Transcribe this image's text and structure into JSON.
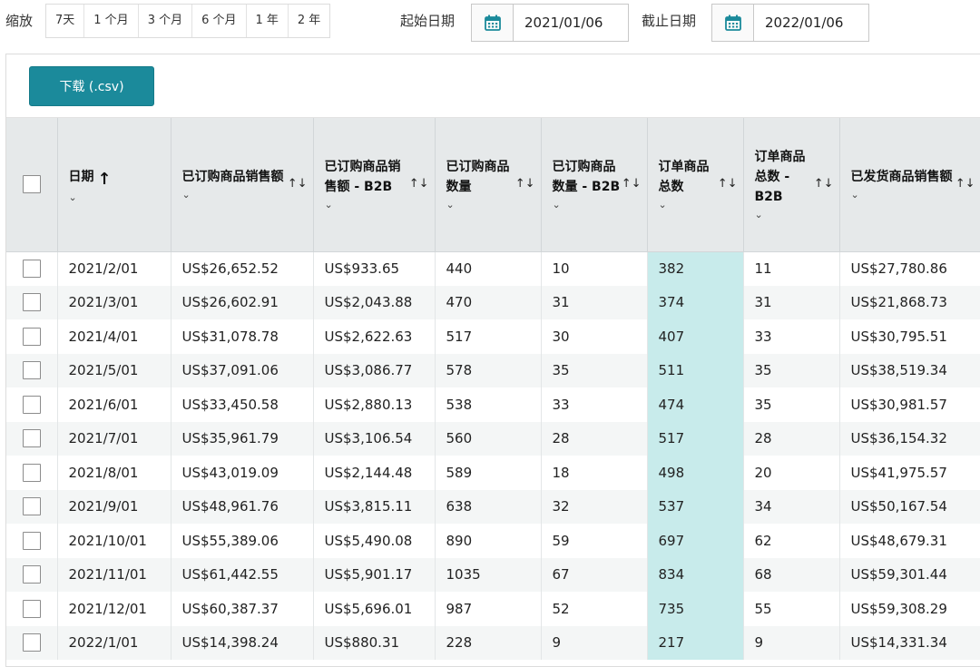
{
  "filters": {
    "zoom_label": "缩放",
    "zoom_options": [
      "7天",
      "1 个月",
      "3 个月",
      "6 个月",
      "1 年",
      "2 年"
    ],
    "start_label": "起始日期",
    "start_value": "2021/01/06",
    "end_label": "截止日期",
    "end_value": "2022/01/06"
  },
  "toolbar": {
    "download_label": "下载 (.csv)"
  },
  "table": {
    "headers": [
      "日期",
      "已订购商品销售额",
      "已订购商品销售额 - B2B",
      "已订购商品数量",
      "已订购商品数量 - B2B",
      "订单商品总数",
      "订单商品总数 - B2B",
      "已发货商品销售额"
    ],
    "rows": [
      [
        "2021/2/01",
        "US$26,652.52",
        "US$933.65",
        "440",
        "10",
        "382",
        "11",
        "US$27,780.86"
      ],
      [
        "2021/3/01",
        "US$26,602.91",
        "US$2,043.88",
        "470",
        "31",
        "374",
        "31",
        "US$21,868.73"
      ],
      [
        "2021/4/01",
        "US$31,078.78",
        "US$2,622.63",
        "517",
        "30",
        "407",
        "33",
        "US$30,795.51"
      ],
      [
        "2021/5/01",
        "US$37,091.06",
        "US$3,086.77",
        "578",
        "35",
        "511",
        "35",
        "US$38,519.34"
      ],
      [
        "2021/6/01",
        "US$33,450.58",
        "US$2,880.13",
        "538",
        "33",
        "474",
        "35",
        "US$30,981.57"
      ],
      [
        "2021/7/01",
        "US$35,961.79",
        "US$3,106.54",
        "560",
        "28",
        "517",
        "28",
        "US$36,154.32"
      ],
      [
        "2021/8/01",
        "US$43,019.09",
        "US$2,144.48",
        "589",
        "18",
        "498",
        "20",
        "US$41,975.57"
      ],
      [
        "2021/9/01",
        "US$48,961.76",
        "US$3,815.11",
        "638",
        "32",
        "537",
        "34",
        "US$50,167.54"
      ],
      [
        "2021/10/01",
        "US$55,389.06",
        "US$5,490.08",
        "890",
        "59",
        "697",
        "62",
        "US$48,679.31"
      ],
      [
        "2021/11/01",
        "US$61,442.55",
        "US$5,901.17",
        "1035",
        "67",
        "834",
        "68",
        "US$59,301.44"
      ],
      [
        "2021/12/01",
        "US$60,387.37",
        "US$5,696.01",
        "987",
        "52",
        "735",
        "55",
        "US$59,308.29"
      ],
      [
        "2022/1/01",
        "US$14,398.24",
        "US$880.31",
        "228",
        "9",
        "217",
        "9",
        "US$14,331.34"
      ]
    ]
  },
  "icons": {
    "calendar": "calendar-icon",
    "sort": "sort-icon",
    "chevron": "chevron-down-icon",
    "sort_ascending": "arrow-up-icon"
  },
  "colors": {
    "accent": "#1b8a9b",
    "highlight_column": "#c8ebeb",
    "header_bg": "#e6e9ea"
  }
}
